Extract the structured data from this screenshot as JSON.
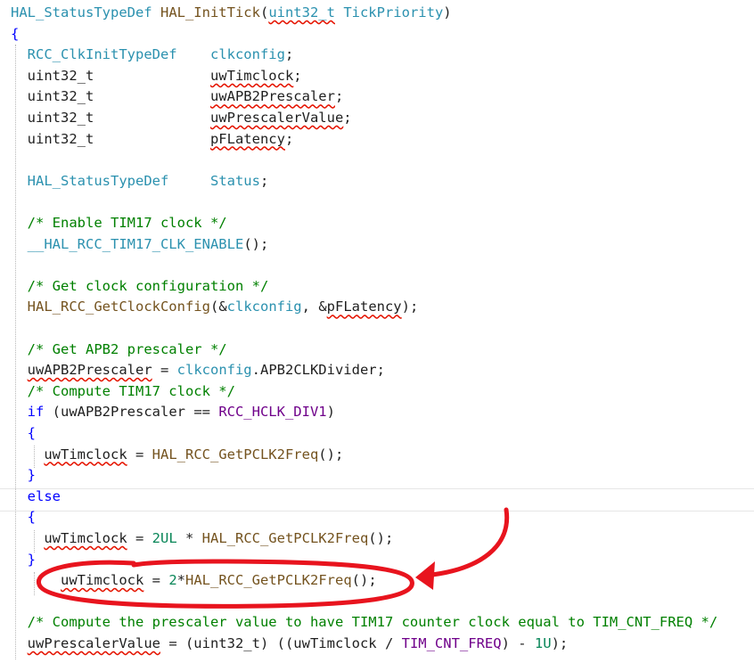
{
  "code": {
    "lines": [
      {
        "tokens": [
          {
            "t": "HAL_StatusTypeDef",
            "c": "ty"
          },
          {
            "t": " "
          },
          {
            "t": "HAL_InitTick",
            "c": "fn"
          },
          {
            "t": "("
          },
          {
            "t": "uint32_t",
            "c": "ty sq"
          },
          {
            "t": " "
          },
          {
            "t": "TickPriority",
            "c": "ty"
          },
          {
            "t": ")"
          }
        ]
      },
      {
        "tokens": [
          {
            "t": "{",
            "c": "kw"
          }
        ]
      },
      {
        "tokens": [
          {
            "t": "  "
          },
          {
            "t": "RCC_ClkInitTypeDef",
            "c": "ty"
          },
          {
            "t": "    "
          },
          {
            "t": "clkconfig",
            "c": "ty"
          },
          {
            "t": ";"
          }
        ]
      },
      {
        "tokens": [
          {
            "t": "  uint32_t              "
          },
          {
            "t": "uwTimclock",
            "c": "sq"
          },
          {
            "t": ";"
          }
        ]
      },
      {
        "tokens": [
          {
            "t": "  uint32_t              "
          },
          {
            "t": "uwAPB2Prescaler",
            "c": "sq"
          },
          {
            "t": ";"
          }
        ]
      },
      {
        "tokens": [
          {
            "t": "  uint32_t              "
          },
          {
            "t": "uwPrescalerValue",
            "c": "sq"
          },
          {
            "t": ";"
          }
        ]
      },
      {
        "tokens": [
          {
            "t": "  uint32_t              "
          },
          {
            "t": "pFLatency",
            "c": "sq"
          },
          {
            "t": ";"
          }
        ]
      },
      {
        "tokens": []
      },
      {
        "tokens": [
          {
            "t": "  "
          },
          {
            "t": "HAL_StatusTypeDef",
            "c": "ty"
          },
          {
            "t": "     "
          },
          {
            "t": "Status",
            "c": "ty"
          },
          {
            "t": ";"
          }
        ]
      },
      {
        "tokens": []
      },
      {
        "tokens": [
          {
            "t": "  "
          },
          {
            "t": "/* Enable TIM17 clock */",
            "c": "cm"
          }
        ]
      },
      {
        "tokens": [
          {
            "t": "  "
          },
          {
            "t": "__HAL_RCC_TIM17_CLK_ENABLE",
            "c": "ty"
          },
          {
            "t": "();"
          }
        ]
      },
      {
        "tokens": []
      },
      {
        "tokens": [
          {
            "t": "  "
          },
          {
            "t": "/* Get clock configuration */",
            "c": "cm"
          }
        ]
      },
      {
        "tokens": [
          {
            "t": "  "
          },
          {
            "t": "HAL_RCC_GetClockConfig",
            "c": "fn"
          },
          {
            "t": "(&"
          },
          {
            "t": "clkconfig",
            "c": "ty"
          },
          {
            "t": ", &"
          },
          {
            "t": "pFLatency",
            "c": "sq"
          },
          {
            "t": ");"
          }
        ]
      },
      {
        "tokens": []
      },
      {
        "tokens": [
          {
            "t": "  "
          },
          {
            "t": "/* Get APB2 prescaler */",
            "c": "cm"
          }
        ]
      },
      {
        "tokens": [
          {
            "t": "  "
          },
          {
            "t": "uwAPB2Prescaler",
            "c": "sq"
          },
          {
            "t": " = "
          },
          {
            "t": "clkconfig",
            "c": "ty"
          },
          {
            "t": ".APB2CLKDivider;"
          }
        ]
      },
      {
        "tokens": [
          {
            "t": "  "
          },
          {
            "t": "/* Compute TIM17 clock */",
            "c": "cm"
          }
        ]
      },
      {
        "tokens": [
          {
            "t": "  "
          },
          {
            "t": "if",
            "c": "kw"
          },
          {
            "t": " (uwAPB2Prescaler == "
          },
          {
            "t": "RCC_HCLK_DIV1",
            "c": "mac"
          },
          {
            "t": ")"
          }
        ]
      },
      {
        "tokens": [
          {
            "t": "  "
          },
          {
            "t": "{",
            "c": "kw"
          }
        ]
      },
      {
        "tokens": [
          {
            "t": "    "
          },
          {
            "t": "uwTimclock",
            "c": "sq"
          },
          {
            "t": " = "
          },
          {
            "t": "HAL_RCC_GetPCLK2Freq",
            "c": "fn"
          },
          {
            "t": "();"
          }
        ]
      },
      {
        "tokens": [
          {
            "t": "  "
          },
          {
            "t": "}",
            "c": "kw"
          }
        ]
      },
      {
        "tokens": [
          {
            "t": "  "
          },
          {
            "t": "else",
            "c": "kw"
          }
        ]
      },
      {
        "tokens": [
          {
            "t": "  "
          },
          {
            "t": "{",
            "c": "kw"
          }
        ]
      },
      {
        "tokens": [
          {
            "t": "    "
          },
          {
            "t": "uwTimclock",
            "c": "sq"
          },
          {
            "t": " = "
          },
          {
            "t": "2UL",
            "c": "num"
          },
          {
            "t": " * "
          },
          {
            "t": "HAL_RCC_GetPCLK2Freq",
            "c": "fn"
          },
          {
            "t": "();"
          }
        ]
      },
      {
        "tokens": [
          {
            "t": "  "
          },
          {
            "t": "}",
            "c": "kw"
          }
        ]
      },
      {
        "tokens": [
          {
            "t": "      "
          },
          {
            "t": "uwTimclock",
            "c": "sq"
          },
          {
            "t": " = "
          },
          {
            "t": "2",
            "c": "num"
          },
          {
            "t": "*"
          },
          {
            "t": "HAL_RCC_GetPCLK2Freq",
            "c": "fn"
          },
          {
            "t": "();"
          }
        ]
      },
      {
        "tokens": []
      },
      {
        "tokens": [
          {
            "t": "  "
          },
          {
            "t": "/* Compute the prescaler value to have TIM17 counter clock equal to TIM_CNT_FREQ */",
            "c": "cm"
          }
        ]
      },
      {
        "tokens": [
          {
            "t": "  "
          },
          {
            "t": "uwPrescalerValue",
            "c": "sq"
          },
          {
            "t": " = (uint32_t) ((uwTimclock / "
          },
          {
            "t": "TIM_CNT_FREQ",
            "c": "mac"
          },
          {
            "t": ") - "
          },
          {
            "t": "1U",
            "c": "num"
          },
          {
            "t": ");"
          }
        ]
      }
    ]
  },
  "annotation": {
    "color": "#e8141e",
    "kind": "hand-drawn circle and arrow highlighting line 28"
  }
}
